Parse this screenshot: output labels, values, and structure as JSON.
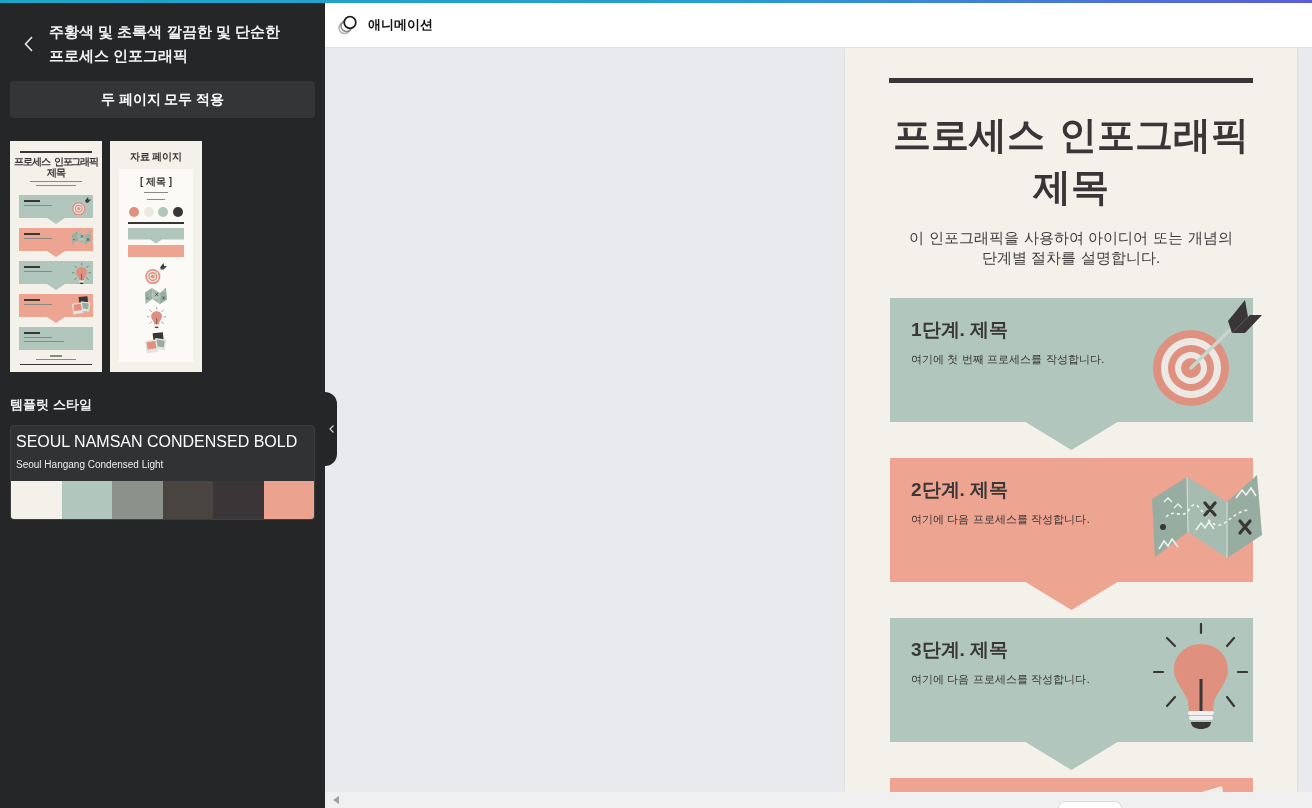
{
  "sidebar": {
    "title": "주황색 및 초록색 깔끔한 및 단순한 프로세스 인포그래픽",
    "apply_button": "두 페이지 모두 적용",
    "thumbnails": [
      {
        "kind": "cover",
        "title": "프로세스 인포그래픽 제목",
        "blocks": [
          {
            "color": "#b1c6bd"
          },
          {
            "color": "#eda490"
          },
          {
            "color": "#b1c6bd"
          },
          {
            "color": "#eda490"
          },
          {
            "color": "#b1c6bd"
          }
        ]
      },
      {
        "kind": "resource",
        "title": "자료 페이지",
        "heading": "[ 제목 ]",
        "swatches": [
          {
            "color": "#e0907e"
          },
          {
            "color": "#ece8e2"
          },
          {
            "color": "#b1c6bd"
          },
          {
            "color": "#3a3637"
          }
        ],
        "blocks": [
          {
            "color": "#b1c6bd"
          },
          {
            "color": "#eda490"
          }
        ]
      }
    ],
    "style_label": "템플릿 스타일",
    "style": {
      "heading_font": "SEOUL NAMSAN CONDENSED BOLD",
      "body_font": "Seoul Hangang Condensed Light",
      "palette": [
        {
          "color": "#f4f0ea"
        },
        {
          "color": "#b1c6bd"
        },
        {
          "color": "#8c928b"
        },
        {
          "color": "#4a4441"
        },
        {
          "color": "#3a3637"
        },
        {
          "color": "#eba38f"
        }
      ]
    }
  },
  "toolbar": {
    "animate_button": "애니메이션"
  },
  "page": {
    "title": "프로세스 인포그래픽 제목",
    "subtitle": "이 인포그래픽을 사용하여 아이디어 또는 개념의 단계별 절차를 설명합니다.",
    "steps": [
      {
        "title": "1단계. 제목",
        "text": "여기에 첫 번째 프로세스를 작성합니다.",
        "color": "#b1c6bd"
      },
      {
        "title": "2단계. 제목",
        "text": "여기에 다음 프로세스를 작성합니다.",
        "color": "#eda490"
      },
      {
        "title": "3단계. 제목",
        "text": "여기에 다음 프로세스를 작성합니다.",
        "color": "#b1c6bd"
      },
      {
        "color": "#eda490"
      }
    ]
  }
}
